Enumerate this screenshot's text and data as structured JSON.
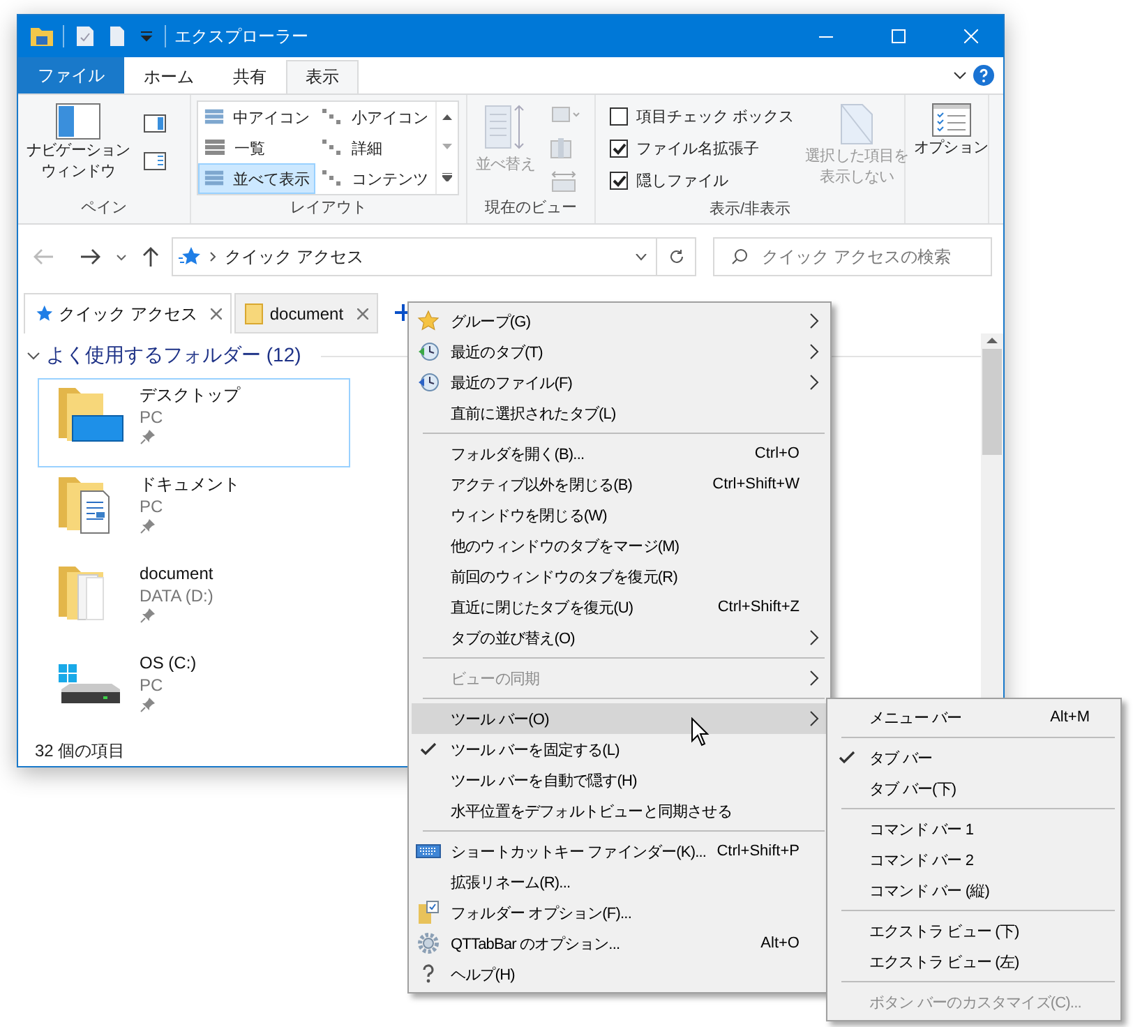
{
  "window": {
    "title": "エクスプローラー"
  },
  "ribbon_tabs": [
    {
      "label": "ファイル",
      "kind": "file",
      "selected": false
    },
    {
      "label": "ホーム",
      "kind": "tab",
      "selected": false
    },
    {
      "label": "共有",
      "kind": "tab",
      "selected": false
    },
    {
      "label": "表示",
      "kind": "tab",
      "selected": true
    }
  ],
  "ribbon": {
    "pane": {
      "button_lines": [
        "ナビゲーション",
        "ウィンドウ"
      ],
      "label": "ペイン"
    },
    "layout": {
      "options": [
        {
          "label": "中アイコン",
          "selected": false
        },
        {
          "label": "小アイコン",
          "selected": false
        },
        {
          "label": "一覧",
          "selected": false
        },
        {
          "label": "詳細",
          "selected": false
        },
        {
          "label": "並べて表示",
          "selected": true
        },
        {
          "label": "コンテンツ",
          "selected": false
        }
      ],
      "label": "レイアウト"
    },
    "current_view": {
      "sort_button": "並べ替え",
      "label": "現在のビュー"
    },
    "show_hide": {
      "checkboxes": [
        {
          "label": "項目チェック ボックス",
          "checked": false
        },
        {
          "label": "ファイル名拡張子",
          "checked": true
        },
        {
          "label": "隠しファイル",
          "checked": true
        }
      ],
      "hide_selected_lines": [
        "選択した項目を",
        "表示しない"
      ],
      "label": "表示/非表示"
    },
    "options": {
      "button": "オプション"
    }
  },
  "address": {
    "path": "クイック アクセス",
    "search_placeholder": "クイック アクセスの検索"
  },
  "tabs": [
    {
      "label": "クイック アクセス",
      "kind": "quick",
      "selected": true
    },
    {
      "label": "document",
      "kind": "folder",
      "selected": false
    }
  ],
  "section": {
    "title": "よく使用するフォルダー (12)",
    "expanded": true
  },
  "folders": [
    {
      "name": "デスクトップ",
      "location": "PC",
      "kind": "desktop",
      "selected": true
    },
    {
      "name": "ドキュメント",
      "location": "PC",
      "kind": "documents",
      "selected": false
    },
    {
      "name": "document",
      "location": "DATA (D:)",
      "kind": "folder",
      "selected": false
    },
    {
      "name": "OS (C:)",
      "location": "PC",
      "kind": "drive",
      "selected": false
    }
  ],
  "status_bar": {
    "count": "32 個の項目"
  },
  "context_menu": {
    "items": [
      {
        "kind": "group",
        "label": "グループ(G)",
        "submenu": true,
        "checked": false,
        "disabled": false,
        "selected": false
      },
      {
        "kind": "recent-tabs",
        "label": "最近のタブ(T)",
        "submenu": true,
        "checked": false,
        "disabled": false,
        "selected": false
      },
      {
        "kind": "recent-files",
        "label": "最近のファイル(F)",
        "submenu": true,
        "checked": false,
        "disabled": false,
        "selected": false
      },
      {
        "kind": "plain",
        "label": "直前に選択されたタブ(L)",
        "submenu": false,
        "checked": false,
        "disabled": false,
        "selected": false
      },
      {
        "kind": "separator"
      },
      {
        "kind": "plain",
        "label": "フォルダを開く(B)...",
        "shortcut": "Ctrl+O",
        "submenu": false,
        "checked": false,
        "disabled": false,
        "selected": false
      },
      {
        "kind": "plain",
        "label": "アクティブ以外を閉じる(B)",
        "shortcut": "Ctrl+Shift+W",
        "submenu": false,
        "checked": false,
        "disabled": false,
        "selected": false
      },
      {
        "kind": "plain",
        "label": "ウィンドウを閉じる(W)",
        "submenu": false,
        "checked": false,
        "disabled": false,
        "selected": false
      },
      {
        "kind": "plain",
        "label": "他のウィンドウのタブをマージ(M)",
        "submenu": false,
        "checked": false,
        "disabled": false,
        "selected": false
      },
      {
        "kind": "plain",
        "label": "前回のウィンドウのタブを復元(R)",
        "submenu": false,
        "checked": false,
        "disabled": false,
        "selected": false
      },
      {
        "kind": "plain",
        "label": "直近に閉じたタブを復元(U)",
        "shortcut": "Ctrl+Shift+Z",
        "submenu": false,
        "checked": false,
        "disabled": false,
        "selected": false
      },
      {
        "kind": "plain",
        "label": "タブの並び替え(O)",
        "submenu": true,
        "checked": false,
        "disabled": false,
        "selected": false
      },
      {
        "kind": "separator"
      },
      {
        "kind": "plain",
        "label": "ビューの同期",
        "submenu": true,
        "checked": false,
        "disabled": true,
        "selected": false
      },
      {
        "kind": "separator"
      },
      {
        "kind": "plain",
        "label": "ツール バー(O)",
        "submenu": true,
        "checked": false,
        "disabled": false,
        "selected": true
      },
      {
        "kind": "plain",
        "label": "ツール バーを固定する(L)",
        "submenu": false,
        "checked": true,
        "disabled": false,
        "selected": false
      },
      {
        "kind": "plain",
        "label": "ツール バーを自動で隠す(H)",
        "submenu": false,
        "checked": false,
        "disabled": false,
        "selected": false
      },
      {
        "kind": "plain",
        "label": "水平位置をデフォルトビューと同期させる",
        "submenu": false,
        "checked": false,
        "disabled": false,
        "selected": false
      },
      {
        "kind": "separator"
      },
      {
        "kind": "keyboard",
        "label": "ショートカットキー ファインダー(K)...",
        "shortcut": "Ctrl+Shift+P",
        "submenu": false,
        "checked": false,
        "disabled": false,
        "selected": false
      },
      {
        "kind": "plain",
        "label": "拡張リネーム(R)...",
        "submenu": false,
        "checked": false,
        "disabled": false,
        "selected": false
      },
      {
        "kind": "folder-options",
        "label": "フォルダー オプション(F)...",
        "submenu": false,
        "checked": false,
        "disabled": false,
        "selected": false
      },
      {
        "kind": "settings",
        "label": "QTTabBar のオプション...",
        "shortcut": "Alt+O",
        "submenu": false,
        "checked": false,
        "disabled": false,
        "selected": false
      },
      {
        "kind": "help",
        "label": "ヘルプ(H)",
        "submenu": false,
        "checked": false,
        "disabled": false,
        "selected": false
      }
    ]
  },
  "submenu": {
    "items": [
      {
        "kind": "plain",
        "label": "メニュー バー",
        "shortcut": "Alt+M",
        "checked": false,
        "disabled": false
      },
      {
        "kind": "separator"
      },
      {
        "kind": "plain",
        "label": "タブ バー",
        "checked": true,
        "disabled": false
      },
      {
        "kind": "plain",
        "label": "タブ バー(下)",
        "checked": false,
        "disabled": false
      },
      {
        "kind": "separator"
      },
      {
        "kind": "plain",
        "label": "コマンド バー 1",
        "checked": false,
        "disabled": false
      },
      {
        "kind": "plain",
        "label": "コマンド バー 2",
        "checked": false,
        "disabled": false
      },
      {
        "kind": "plain",
        "label": "コマンド バー (縦)",
        "checked": false,
        "disabled": false
      },
      {
        "kind": "separator"
      },
      {
        "kind": "plain",
        "label": "エクストラ ビュー (下)",
        "checked": false,
        "disabled": false
      },
      {
        "kind": "plain",
        "label": "エクストラ ビュー (左)",
        "checked": false,
        "disabled": false
      },
      {
        "kind": "separator"
      },
      {
        "kind": "plain",
        "label": "ボタン バーのカスタマイズ(C)...",
        "checked": false,
        "disabled": true
      }
    ]
  }
}
